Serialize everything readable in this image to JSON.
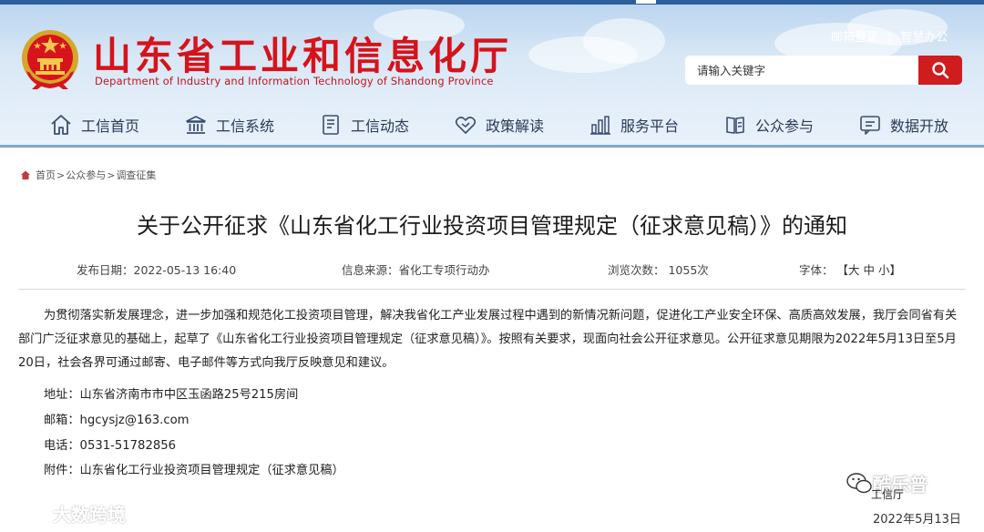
{
  "header": {
    "site_title": "山东省工业和信息化厅",
    "site_subtitle": "Department of Industry and Information Technology of Shandong Province",
    "top_links": [
      "邮箱登录",
      "智慧办公"
    ],
    "top_link_separator": "|",
    "search_placeholder": "请输入关键字",
    "accent_color": "#cf1c1f"
  },
  "nav": {
    "items": [
      {
        "label": "工信首页",
        "icon": "home-icon"
      },
      {
        "label": "工信系统",
        "icon": "building-icon"
      },
      {
        "label": "工信动态",
        "icon": "document-list-icon"
      },
      {
        "label": "政策解读",
        "icon": "handshake-icon"
      },
      {
        "label": "服务平台",
        "icon": "chart-bar-icon"
      },
      {
        "label": "公众参与",
        "icon": "book-icon"
      },
      {
        "label": "数据开放",
        "icon": "message-icon"
      }
    ]
  },
  "breadcrumb": {
    "items": [
      "首页",
      "公众参与",
      "调查征集"
    ],
    "separator": ">"
  },
  "article": {
    "title": "关于公开征求《山东省化工行业投资项目管理规定（征求意见稿）》的通知",
    "publish_date": "发布日期：2022-05-13 16:40",
    "source": "信息来源：省化工专项行动办",
    "views": "浏览次数： 1055次",
    "font_size_label": "字体：",
    "font_size_options": [
      "【大",
      "中",
      "小】"
    ],
    "body_paragraph": "为贯彻落实新发展理念，进一步加强和规范化工投资项目管理，解决我省化工产业发展过程中遇到的新情况新问题，促进化工产业安全环保、高质高效发展，我厅会同省有关部门广泛征求意见的基础上，起草了《山东省化工行业投资项目管理规定（征求意见稿）》。按照有关要求，现面向社会公开征求意见。公开征求意见期限为2022年5月13日至5月20日，社会各界可通过邮寄、电子邮件等方式向我厅反映意见和建议。",
    "address": "地址：山东省济南市市中区玉函路25号215房间",
    "email": "邮箱：hgcysjz@163.com",
    "phone": "电话：0531-51782856",
    "attachment": "附件：山东省化工行业投资项目管理规定（征求意见稿）"
  },
  "watermarks": {
    "left": "大数跨境",
    "right_name": "酷乐普",
    "right_sub": "工信厅",
    "date": "2022年5月13日"
  }
}
